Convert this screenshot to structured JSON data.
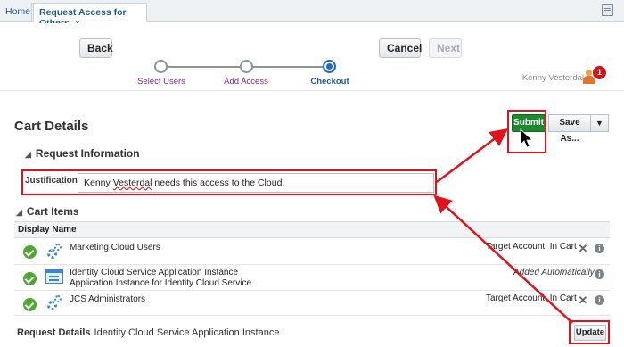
{
  "tabs": {
    "home_label": "Home",
    "active_label": "Request Access for Others",
    "close_glyph": "×"
  },
  "toolbar": {
    "back_label": "Back",
    "cancel_label": "Cancel",
    "next_label": "Next"
  },
  "train": {
    "steps": [
      {
        "label": "Select Users",
        "state": "visited"
      },
      {
        "label": "Add Access",
        "state": "visited"
      },
      {
        "label": "Checkout",
        "state": "current"
      }
    ]
  },
  "user": {
    "name": "Kenny Vesterdal",
    "notification_count": "1"
  },
  "cart": {
    "title": "Cart Details",
    "submit_label": "Submit",
    "save_as_label": "Save As...",
    "dropdown_glyph": "▼"
  },
  "request_info": {
    "header": "Request Information",
    "justification_label": "Justification",
    "justification_pre": "Kenny ",
    "justification_misspelled": "Vesterdal",
    "justification_post": " needs this access to the Cloud."
  },
  "cart_items": {
    "header": "Cart Items",
    "column_header": "Display Name",
    "rows": [
      {
        "name_line1": "Marketing Cloud Users",
        "name_line2": "",
        "status": "Target Account: In Cart",
        "icon": "gear-icon"
      },
      {
        "name_line1": "Identity Cloud Service Application Instance",
        "name_line2": "Application Instance for Identity Cloud Service",
        "status": "Added Automatically",
        "icon": "app-instance-icon"
      },
      {
        "name_line1": "JCS Administrators",
        "name_line2": "",
        "status": "Target Account: In Cart",
        "icon": "gear-icon"
      }
    ]
  },
  "request_details": {
    "label": "Request Details",
    "value": "Identity Cloud Service Application Instance",
    "update_label": "Update"
  },
  "colors": {
    "highlight": "#e2111a",
    "submit_green": "#1c8a2f",
    "train_current": "#1a6ad1",
    "train_label": "#7b2590"
  }
}
